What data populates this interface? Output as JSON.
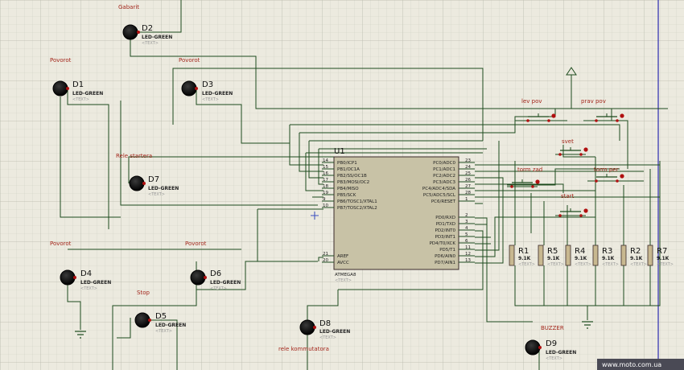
{
  "leds": [
    {
      "ref": "D2",
      "value": "LED-GREEN",
      "text": "<TEXT>",
      "note": "Gabarit"
    },
    {
      "ref": "D1",
      "value": "LED-GREEN",
      "text": "<TEXT>",
      "note": "Povorot"
    },
    {
      "ref": "D3",
      "value": "LED-GREEN",
      "text": "<TEXT>",
      "note": "Povorot"
    },
    {
      "ref": "D7",
      "value": "LED-GREEN",
      "text": "<TEXT>",
      "note": "Rele startera"
    },
    {
      "ref": "D4",
      "value": "LED-GREEN",
      "text": "<TEXT>",
      "note": "Povorot"
    },
    {
      "ref": "D6",
      "value": "LED-GREEN",
      "text": "<TEXT>",
      "note": "Povorot"
    },
    {
      "ref": "D5",
      "value": "LED-GREEN",
      "text": "<TEXT>",
      "note": "Stop"
    },
    {
      "ref": "D8",
      "value": "LED-GREEN",
      "text": "<TEXT>",
      "note": "rele kommutatora"
    },
    {
      "ref": "D9",
      "value": "LED-GREEN",
      "text": "<TEXT>",
      "note": "BUZZER"
    }
  ],
  "mcu": {
    "ref": "U1",
    "part": "ATMEGA8",
    "text": "<TEXT>",
    "left_pins": [
      {
        "num": "14",
        "name": "PB0/ICP1"
      },
      {
        "num": "15",
        "name": "PB1/OC1A"
      },
      {
        "num": "16",
        "name": "PB2/SS/OC1B"
      },
      {
        "num": "17",
        "name": "PB3/MOSI/OC2"
      },
      {
        "num": "18",
        "name": "PB4/MISO"
      },
      {
        "num": "19",
        "name": "PB5/SCK"
      },
      {
        "num": "9",
        "name": "PB6/TOSC1/XTAL1"
      },
      {
        "num": "10",
        "name": "PB7/TOSC2/XTAL2"
      },
      {
        "num": "21",
        "name": "AREF"
      },
      {
        "num": "20",
        "name": "AVCC"
      }
    ],
    "right_pins": [
      {
        "num": "23",
        "name": "PC0/ADC0"
      },
      {
        "num": "24",
        "name": "PC1/ADC1"
      },
      {
        "num": "25",
        "name": "PC2/ADC2"
      },
      {
        "num": "26",
        "name": "PC3/ADC3"
      },
      {
        "num": "27",
        "name": "PC4/ADC4/SDA"
      },
      {
        "num": "28",
        "name": "PC5/ADC5/SCL"
      },
      {
        "num": "1",
        "name": "PC6/RESET"
      },
      {
        "num": "2",
        "name": "PD0/RXD"
      },
      {
        "num": "3",
        "name": "PD1/TXD"
      },
      {
        "num": "4",
        "name": "PD2/INT0"
      },
      {
        "num": "5",
        "name": "PD3/INT1"
      },
      {
        "num": "6",
        "name": "PD4/T0/XCK"
      },
      {
        "num": "11",
        "name": "PD5/T1"
      },
      {
        "num": "12",
        "name": "PD6/AIN0"
      },
      {
        "num": "13",
        "name": "PD7/AIN1"
      }
    ]
  },
  "buttons": [
    {
      "label": "lev pov"
    },
    {
      "label": "prav pov"
    },
    {
      "label": "svet"
    },
    {
      "label": "torm zad"
    },
    {
      "label": "torm per"
    },
    {
      "label": "start"
    }
  ],
  "resistors": [
    {
      "ref": "R1",
      "value": "9.1K",
      "text": "<TEXT>"
    },
    {
      "ref": "R5",
      "value": "9.1K",
      "text": "<TEXT>"
    },
    {
      "ref": "R4",
      "value": "9.1K",
      "text": "<TEXT>"
    },
    {
      "ref": "R3",
      "value": "9.1K",
      "text": "<TEXT>"
    },
    {
      "ref": "R2",
      "value": "9.1K",
      "text": "<TEXT>"
    },
    {
      "ref": "R7",
      "value": "9.1K",
      "text": "<TEXT>"
    }
  ],
  "watermark": "www.moto.com.ua",
  "colors": {
    "background": "#eceadf",
    "wire": "#1c4a1c",
    "led": "#b01010",
    "label": "#a3271c",
    "chip": "#c8c2a6"
  }
}
